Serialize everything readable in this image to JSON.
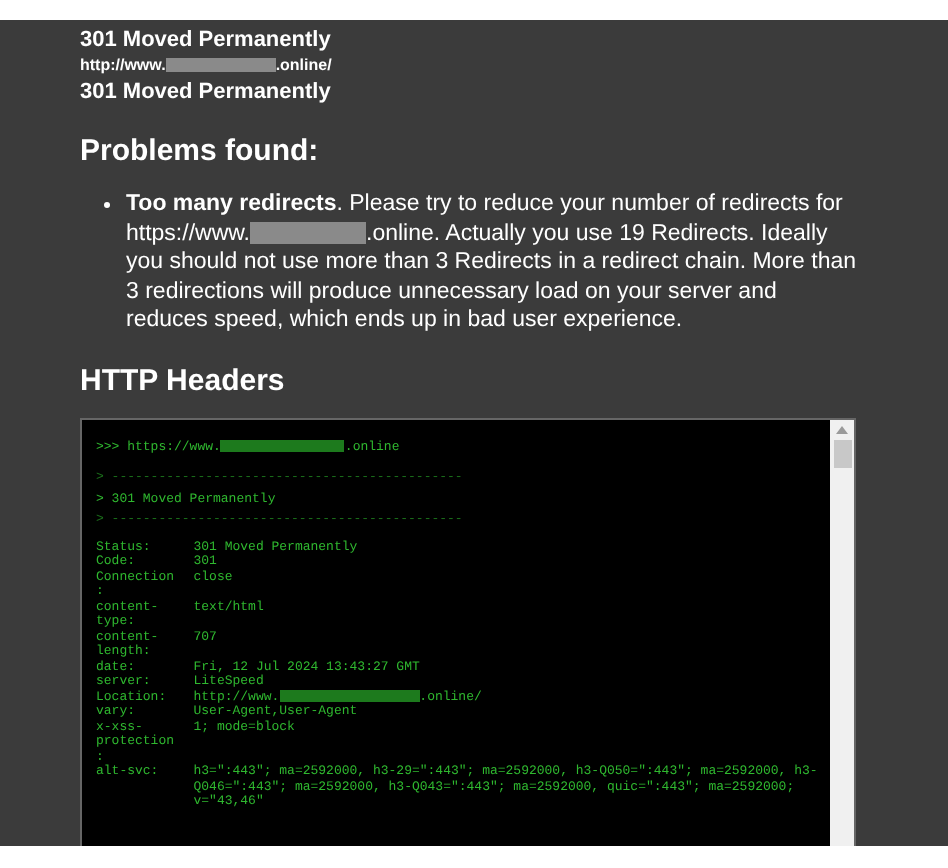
{
  "redirect_chain": [
    {
      "kind": "status",
      "text": "301 Moved Permanently"
    },
    {
      "kind": "url",
      "prefix": "http://www.",
      "suffix": ".online/"
    },
    {
      "kind": "status",
      "text": "301 Moved Permanently"
    }
  ],
  "problems": {
    "title": "Problems found:",
    "items": [
      {
        "lead": "Too many redirects",
        "before": ". Please try to reduce your number of redirects for https://www.",
        "after": ".online. Actually you use 19 Redirects. Ideally you should not use more than 3 Redirects in a redirect chain. More than 3 redirections will produce unnecessary load on your server and reduces speed, which ends up in bad user experience."
      }
    ]
  },
  "headers": {
    "title": "HTTP Headers",
    "console": {
      "prompt_prefix": ">>> https://www.",
      "prompt_suffix": ".online",
      "lines": [
        {
          "kind": "divider",
          "text": "> ---------------------------------------------"
        },
        {
          "kind": "status",
          "text": "> 301 Moved Permanently"
        },
        {
          "kind": "divider",
          "text": "> ---------------------------------------------"
        }
      ],
      "rows": [
        {
          "key": "Status:",
          "value": "301 Moved Permanently"
        },
        {
          "key": "Code:",
          "value": "301"
        },
        {
          "key": "Connection:",
          "value": "close"
        },
        {
          "key": "content-type:",
          "value": "text/html"
        },
        {
          "key": "content-length:",
          "value": "707"
        },
        {
          "key": "date:",
          "value": "Fri, 12 Jul 2024 13:43:27 GMT"
        },
        {
          "key": "server:",
          "value": "LiteSpeed"
        },
        {
          "key": "Location:",
          "value": "http://www.",
          "value_suffix": ".online/"
        },
        {
          "key": "vary:",
          "value": "User-Agent,User-Agent"
        },
        {
          "key": "x-xss-protection:",
          "value": "1; mode=block"
        },
        {
          "key": "alt-svc:",
          "value": "h3=\":443\"; ma=2592000, h3-29=\":443\"; ma=2592000, h3-Q050=\":443\"; ma=2592000, h3-Q046=\":443\"; ma=2592000, h3-Q043=\":443\"; ma=2592000, quic=\":443\"; ma=2592000; v=\"43,46\""
        }
      ]
    }
  }
}
